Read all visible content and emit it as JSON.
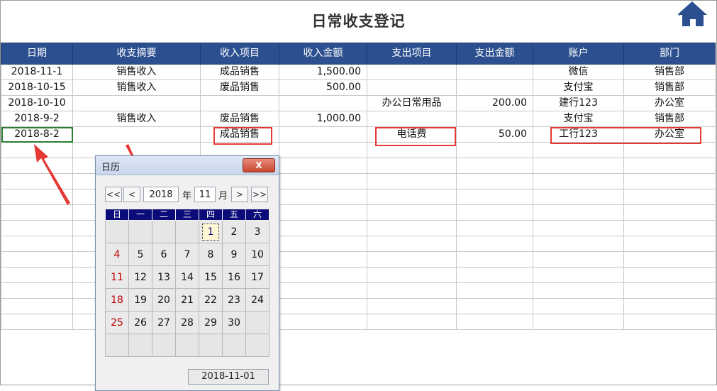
{
  "title": "日常收支登记",
  "home_icon": "home-icon",
  "columns": [
    "日期",
    "收支摘要",
    "收入项目",
    "收入金额",
    "支出项目",
    "支出金额",
    "账户",
    "部门"
  ],
  "rows": [
    [
      "2018-11-1",
      "销售收入",
      "成品销售",
      "1,500.00",
      "",
      "",
      "微信",
      "销售部"
    ],
    [
      "2018-10-15",
      "销售收入",
      "废品销售",
      "500.00",
      "",
      "",
      "支付宝",
      "销售部"
    ],
    [
      "2018-10-10",
      "",
      "",
      "",
      "办公日常用品",
      "200.00",
      "建行123",
      "办公室"
    ],
    [
      "2018-9-2",
      "销售收入",
      "废品销售",
      "1,000.00",
      "",
      "",
      "支付宝",
      "销售部"
    ],
    [
      "2018-8-2",
      "",
      "成品销售",
      "",
      "电话费",
      "50.00",
      "工行123",
      "办公室"
    ]
  ],
  "calendar": {
    "title": "日历",
    "close_label": "X",
    "year": "2018",
    "year_unit": "年",
    "month": "11",
    "month_unit": "月",
    "nav": {
      "first": "<<",
      "prev": "<",
      "next": ">",
      "last": ">>"
    },
    "weekdays": [
      "日",
      "一",
      "二",
      "三",
      "四",
      "五",
      "六"
    ],
    "weeks": [
      [
        "",
        "",
        "",
        "",
        "1",
        "2",
        "3"
      ],
      [
        "4",
        "5",
        "6",
        "7",
        "8",
        "9",
        "10"
      ],
      [
        "11",
        "12",
        "13",
        "14",
        "15",
        "16",
        "17"
      ],
      [
        "18",
        "19",
        "20",
        "21",
        "22",
        "23",
        "24"
      ],
      [
        "25",
        "26",
        "27",
        "28",
        "29",
        "30",
        ""
      ],
      [
        "",
        "",
        "",
        "",
        "",
        "",
        ""
      ]
    ],
    "selected_day": "1",
    "footer_date": "2018-11-01"
  },
  "colors": {
    "header_bg": "#2c4f8f",
    "highlight": "#e53935",
    "weekday_bg": "#0b0b7a",
    "sunday": "#c00000"
  }
}
